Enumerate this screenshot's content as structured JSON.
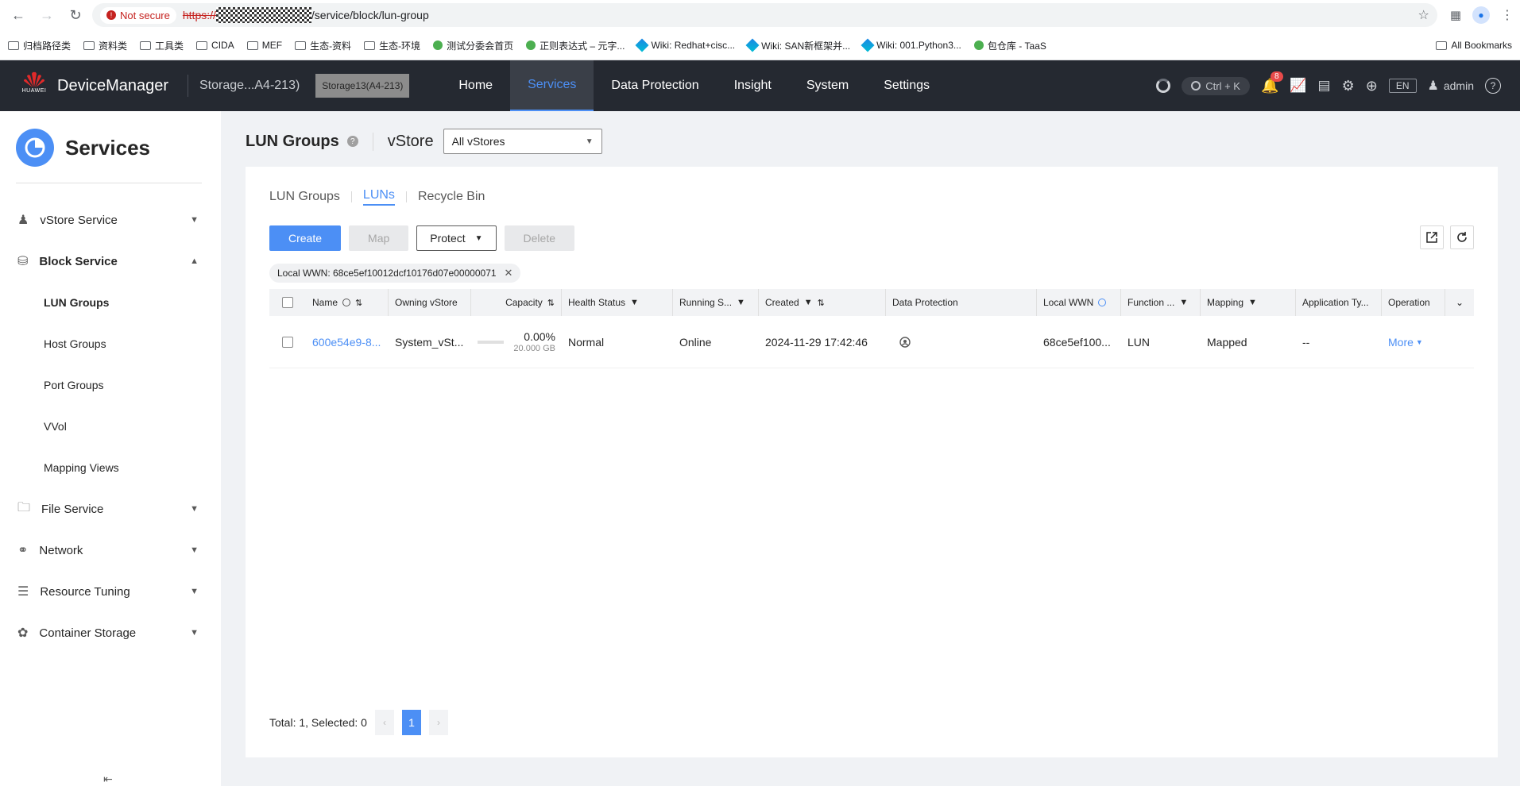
{
  "browser": {
    "not_secure": "Not secure",
    "url_scheme": "https://",
    "url_path": "/service/block/lun-group",
    "bookmarks": [
      {
        "label": "归档路径类",
        "type": "folder"
      },
      {
        "label": "资料类",
        "type": "folder"
      },
      {
        "label": "工具类",
        "type": "folder"
      },
      {
        "label": "CIDA",
        "type": "folder"
      },
      {
        "label": "MEF",
        "type": "folder"
      },
      {
        "label": "生态-资料",
        "type": "folder"
      },
      {
        "label": "生态-环境",
        "type": "folder"
      },
      {
        "label": "测试分委会首页",
        "type": "site"
      },
      {
        "label": "正则表达式 – 元字...",
        "type": "site"
      },
      {
        "label": "Wiki: Redhat+cisc...",
        "type": "wiki"
      },
      {
        "label": "Wiki: SAN新框架并...",
        "type": "wiki"
      },
      {
        "label": "Wiki: 001.Python3...",
        "type": "wiki"
      },
      {
        "label": "包仓库 - TaaS",
        "type": "site"
      }
    ],
    "all_bookmarks": "All Bookmarks"
  },
  "header": {
    "logo_sub": "HUAWEI",
    "app_name": "DeviceManager",
    "storage_name": "Storage...A4-213)",
    "tooltip": "Storage13(A4-213)",
    "nav": [
      "Home",
      "Services",
      "Data Protection",
      "Insight",
      "System",
      "Settings"
    ],
    "active_nav": "Services",
    "search_hint": "Ctrl + K",
    "notifications": "8",
    "lang": "EN",
    "user": "admin"
  },
  "sidebar": {
    "title": "Services",
    "items": [
      {
        "label": "vStore Service"
      },
      {
        "label": "Block Service"
      },
      {
        "label": "File Service"
      },
      {
        "label": "Network"
      },
      {
        "label": "Resource Tuning"
      },
      {
        "label": "Container Storage"
      }
    ],
    "block_sub": [
      "LUN Groups",
      "Host Groups",
      "Port Groups",
      "VVol",
      "Mapping Views"
    ]
  },
  "page": {
    "title": "LUN Groups",
    "vstore_label": "vStore",
    "vstore_value": "All vStores",
    "tabs": [
      "LUN Groups",
      "LUNs",
      "Recycle Bin"
    ],
    "active_tab": "LUNs",
    "buttons": {
      "create": "Create",
      "map": "Map",
      "protect": "Protect",
      "delete": "Delete"
    },
    "filter_chip": "Local WWN: 68ce5ef10012dcf10176d07e00000071"
  },
  "table": {
    "columns": [
      "Name",
      "Owning vStore",
      "Capacity",
      "Health Status",
      "Running S...",
      "Created",
      "Data Protection",
      "Local WWN",
      "Function ...",
      "Mapping",
      "Application Ty...",
      "Operation"
    ],
    "rows": [
      {
        "name": "600e54e9-8...",
        "vstore": "System_vSt...",
        "capacity_pct": "0.00%",
        "capacity_total": "20.000 GB",
        "health": "Normal",
        "running": "Online",
        "created": "2024-11-29 17:42:46",
        "local_wwn": "68ce5ef100...",
        "function": "LUN",
        "mapping": "Mapped",
        "app_type": "--",
        "operation": "More"
      }
    ]
  },
  "pagination": {
    "summary": "Total: 1, Selected: 0",
    "current": "1"
  },
  "colors": {
    "accent": "#4c8ff5",
    "header_bg": "#252931"
  }
}
